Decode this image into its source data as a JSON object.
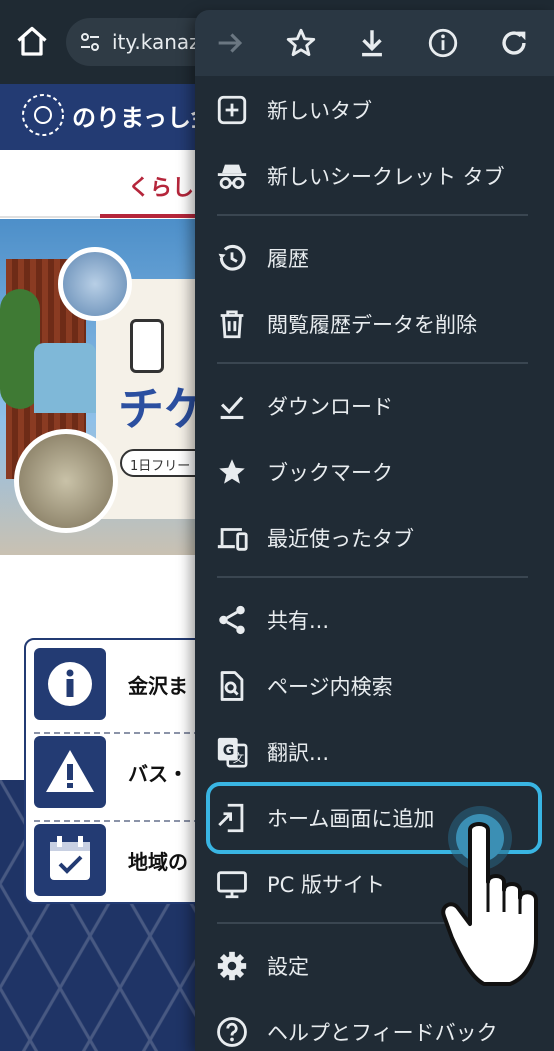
{
  "browser": {
    "url_text": "ity.kanaz"
  },
  "site": {
    "name": "のりまっし金",
    "nav_tab": "くらし",
    "hero_big_text": "チケ",
    "hero_sub_text": "1日フリー",
    "info_rows": [
      {
        "icon": "info-icon",
        "text": "金沢ま"
      },
      {
        "icon": "warning-icon",
        "text": "バス・"
      },
      {
        "icon": "calendar-icon",
        "text": "地域の"
      }
    ]
  },
  "menu": {
    "toolbar_icons": [
      "forward-icon",
      "star-icon",
      "download-icon",
      "info-icon",
      "refresh-icon"
    ],
    "items": [
      {
        "label": "新しいタブ",
        "icon": "new-tab-icon"
      },
      {
        "label": "新しいシークレット タブ",
        "icon": "incognito-icon"
      },
      {
        "label": "履歴",
        "icon": "history-icon"
      },
      {
        "label": "閲覧履歴データを削除",
        "icon": "trash-icon"
      },
      {
        "label": "ダウンロード",
        "icon": "downloads-icon"
      },
      {
        "label": "ブックマーク",
        "icon": "star-filled-icon"
      },
      {
        "label": "最近使ったタブ",
        "icon": "devices-icon"
      },
      {
        "label": "共有...",
        "icon": "share-icon"
      },
      {
        "label": "ページ内検索",
        "icon": "find-in-page-icon"
      },
      {
        "label": "翻訳...",
        "icon": "translate-icon"
      },
      {
        "label": "ホーム画面に追加",
        "icon": "add-to-home-icon"
      },
      {
        "label": "PC 版サイト",
        "icon": "monitor-icon"
      },
      {
        "label": "設定",
        "icon": "gear-icon"
      },
      {
        "label": "ヘルプとフィードバック",
        "icon": "help-icon"
      }
    ]
  },
  "colors": {
    "menu_bg": "#202b35",
    "highlight": "#39b5e3",
    "site_navy": "#233b73",
    "site_red": "#b5263b"
  }
}
